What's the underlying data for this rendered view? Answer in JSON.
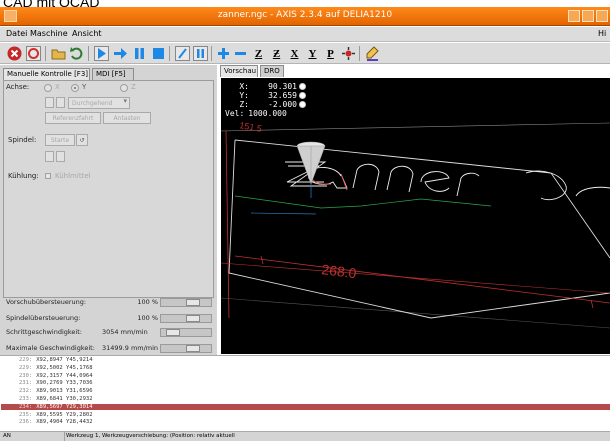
{
  "caption": "CAD mit QCAD",
  "window": {
    "title": "zanner.ngc - AXIS 2.3.4 auf DELIA1210"
  },
  "menu": {
    "items": [
      "Datei",
      "Maschine",
      "Ansicht"
    ],
    "help": "Hi"
  },
  "left_tabs": [
    "Manuelle Kontrolle [F3]",
    "MDI [F5]"
  ],
  "manual": {
    "axis_label": "Achse:",
    "axes": [
      "X",
      "Y",
      "Z"
    ],
    "selected_axis": "Y",
    "jog_mode": "Durchgehend",
    "home_button": "Referenzfahrt",
    "touch_off_button": "Antasten",
    "spindle_label": "Spindel:",
    "spindle_start": "Starte",
    "cooling_label": "Kühlung:",
    "coolant_option": "Kühlmittel"
  },
  "overrides": [
    {
      "label": "Vorschubübersteuerung:",
      "value": "100 %",
      "level": 0.7
    },
    {
      "label": "Spindelübersteuerung:",
      "value": "100 %",
      "level": 0.7
    },
    {
      "label": "Schrittgeschwindigkeit:",
      "value": "3054 mm/min",
      "level": 0.15
    },
    {
      "label": "Maximale Geschwindigkeit:",
      "value": "31499.9 mm/min",
      "level": 0.7
    }
  ],
  "right_tabs": [
    "Vorschau",
    "DRO"
  ],
  "dro": {
    "axes": [
      {
        "axis": "X:",
        "value": "90.301"
      },
      {
        "axis": "Y:",
        "value": "32.659"
      },
      {
        "axis": "Z:",
        "value": "-2.000"
      }
    ],
    "vel_label": "Vel:",
    "vel_value": "1000.000"
  },
  "preview": {
    "word": "Zanner",
    "dimension_label": "268.0",
    "side_dimension": "151.5"
  },
  "gcode": [
    {
      "ln": "229:",
      "code": "X92,8947 Y45,9214"
    },
    {
      "ln": "229:",
      "code": "X92,5002 Y45,1768"
    },
    {
      "ln": "230:",
      "code": "X92,3157 Y44,0964"
    },
    {
      "ln": "231:",
      "code": "X90,2769 Y33,7036"
    },
    {
      "ln": "232:",
      "code": "X89,9013 Y31,6596"
    },
    {
      "ln": "233:",
      "code": "X89,6841 Y30,2932"
    },
    {
      "ln": "234:",
      "code": "X89,5697 Y29,3014",
      "highlight": true
    },
    {
      "ln": "235:",
      "code": "X89,5595 Y29,2802"
    },
    {
      "ln": "236:",
      "code": "X89,4904 Y28,4432"
    }
  ],
  "status": {
    "left": "AN",
    "message": "Werkzeug 1, Werkzeugverschiebung: (Position: relativ aktuell"
  },
  "colors": {
    "title_bar": "#f07810",
    "toolpath": "#ffffff",
    "rapid": "#d23c3c",
    "cone": "#cfcfcf",
    "highlight": "#b44a4a"
  }
}
